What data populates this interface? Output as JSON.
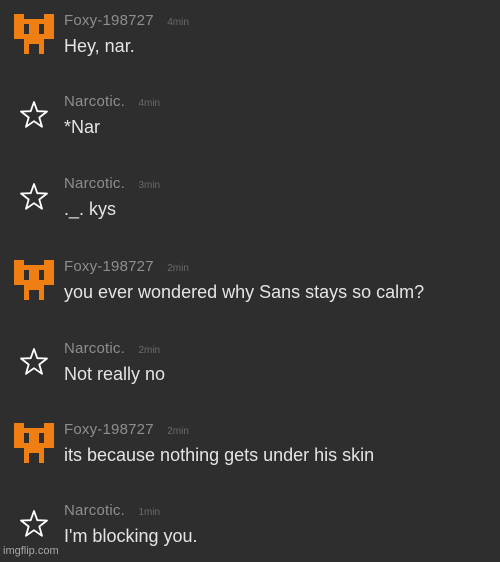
{
  "chat": {
    "messages": [
      {
        "username": "Foxy-198727",
        "time": "4min",
        "text": "Hey, nar.",
        "avatar_icon": "pixel-fox-icon",
        "avatar_color": "#f07f13"
      },
      {
        "username": "Narcotic.",
        "time": "4min",
        "text": "*Nar",
        "avatar_icon": "star-icon",
        "avatar_color": "#ffffff"
      },
      {
        "username": "Narcotic.",
        "time": "3min",
        "text": "._. kys",
        "avatar_icon": "star-icon",
        "avatar_color": "#ffffff"
      },
      {
        "username": "Foxy-198727",
        "time": "2min",
        "text": "you ever wondered why Sans stays so calm?",
        "avatar_icon": "pixel-fox-icon",
        "avatar_color": "#f07f13"
      },
      {
        "username": "Narcotic.",
        "time": "2min",
        "text": "Not really no",
        "avatar_icon": "star-icon",
        "avatar_color": "#ffffff"
      },
      {
        "username": "Foxy-198727",
        "time": "2min",
        "text": "its because nothing gets under his skin",
        "avatar_icon": "pixel-fox-icon",
        "avatar_color": "#f07f13"
      },
      {
        "username": "Narcotic.",
        "time": "1min",
        "text": "I'm blocking you.",
        "avatar_icon": "star-icon",
        "avatar_color": "#ffffff"
      }
    ]
  },
  "watermark": "imgflip.com"
}
